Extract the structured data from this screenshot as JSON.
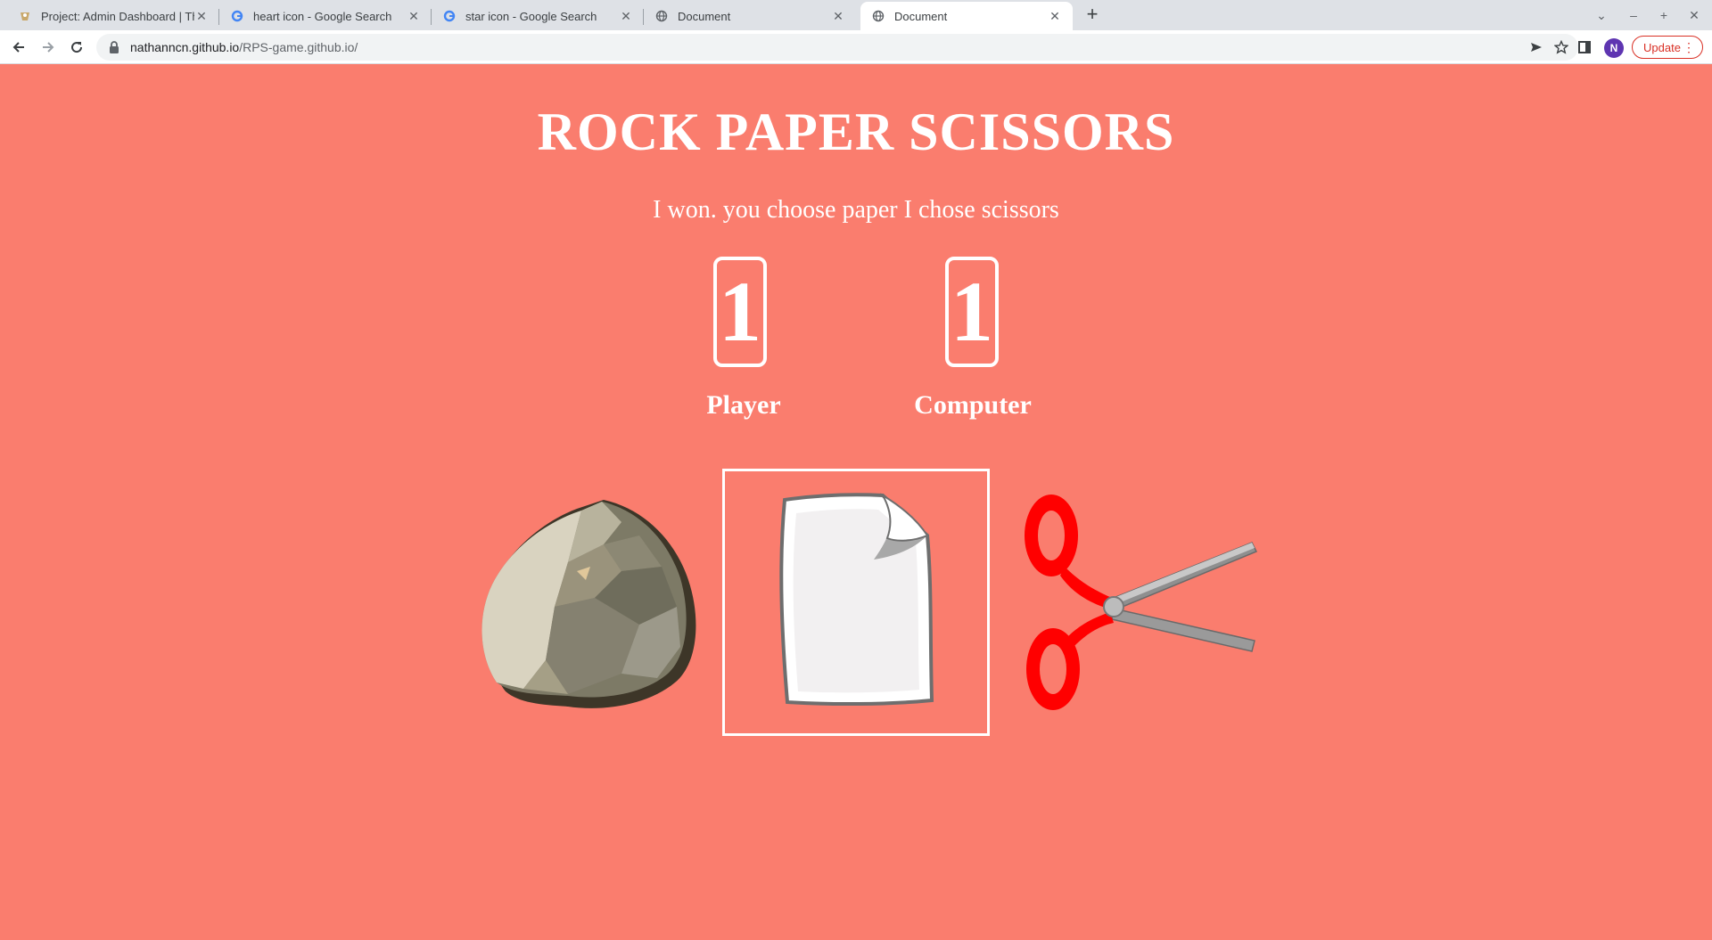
{
  "browser": {
    "tabs": [
      {
        "title": "Project: Admin Dashboard | Th",
        "favicon": "odin-icon",
        "active": false
      },
      {
        "title": "heart icon - Google Search",
        "favicon": "google-icon",
        "active": false
      },
      {
        "title": "star icon - Google Search",
        "favicon": "google-icon",
        "active": false
      },
      {
        "title": "Document",
        "favicon": "globe-icon",
        "active": false
      },
      {
        "title": "Document",
        "favicon": "globe-icon",
        "active": true
      }
    ],
    "url_host": "nathanncn.github.io",
    "url_path": "/RPS-game.github.io/",
    "profile_initial": "N",
    "update_label": "Update"
  },
  "game": {
    "title": "ROCK PAPER SCISSORS",
    "message": "I won. you choose paper I chose scissors",
    "player_score": "1",
    "computer_score": "1",
    "player_label": "Player",
    "computer_label": "Computer",
    "choices": [
      "rock",
      "paper",
      "scissors"
    ],
    "selected_choice": "paper"
  },
  "colors": {
    "page_background": "#fa7d6e",
    "text": "#ffffff",
    "scissors_handle": "#ff0000",
    "scissors_blade": "#8f8f8f"
  }
}
